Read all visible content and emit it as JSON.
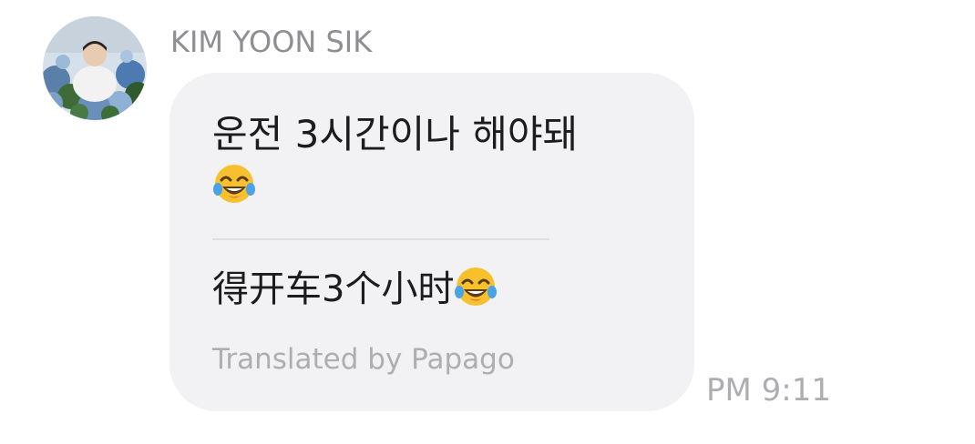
{
  "message": {
    "sender_name": "KIM YOON SIK",
    "original_text": "운전 3시간이나 해야돼",
    "original_emoji": "face-with-tears-of-joy-icon",
    "translated_text": "得开车3个小时",
    "translated_emoji": "face-with-tears-of-joy-icon",
    "translation_credit": "Translated by Papago",
    "time": "PM 9:11"
  },
  "colors": {
    "bubble_background": "#f2f2f4",
    "text_primary": "#1c1c1e",
    "text_secondary": "#8e8e93",
    "text_muted": "#aeaeb2",
    "divider": "#dedee2"
  }
}
